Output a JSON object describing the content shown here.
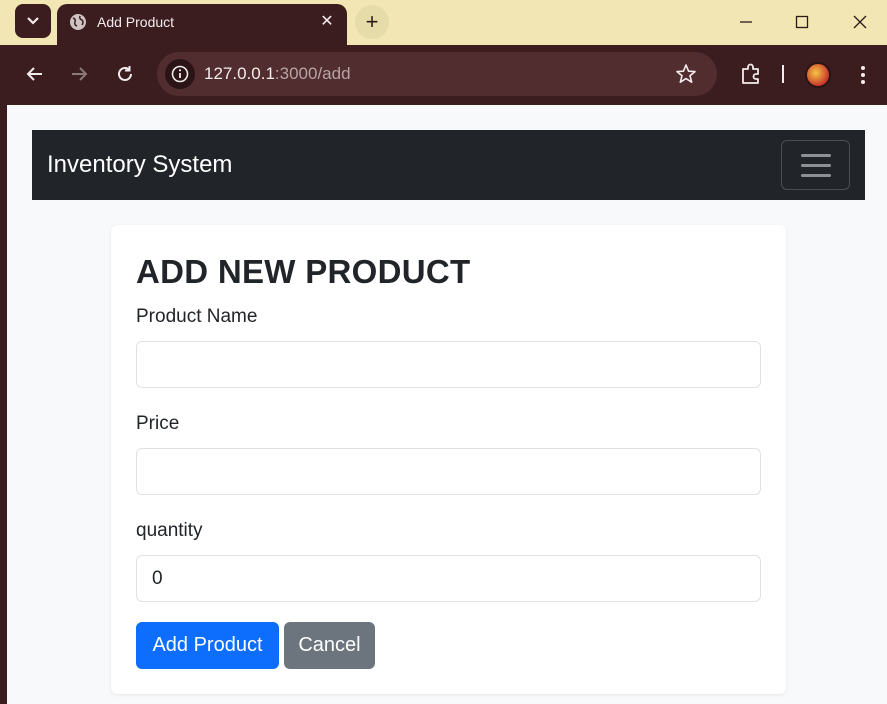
{
  "browser": {
    "tab_title": "Add Product",
    "url_host": "127.0.0.1",
    "url_rest": ":3000/add",
    "new_tab_symbol": "+",
    "close_symbol": "✕"
  },
  "navbar": {
    "brand": "Inventory System"
  },
  "form": {
    "heading": "ADD NEW PRODUCT",
    "name_label": "Product Name",
    "name_value": "",
    "price_label": "Price",
    "price_value": "",
    "quantity_label": "quantity",
    "quantity_value": "0",
    "submit_label": "Add Product",
    "cancel_label": "Cancel"
  },
  "colors": {
    "navbar_bg": "#212529",
    "primary": "#0d6efd",
    "secondary": "#6c757d",
    "browser_frame": "#3b1d20",
    "tabstrip": "#f2e7b4"
  }
}
